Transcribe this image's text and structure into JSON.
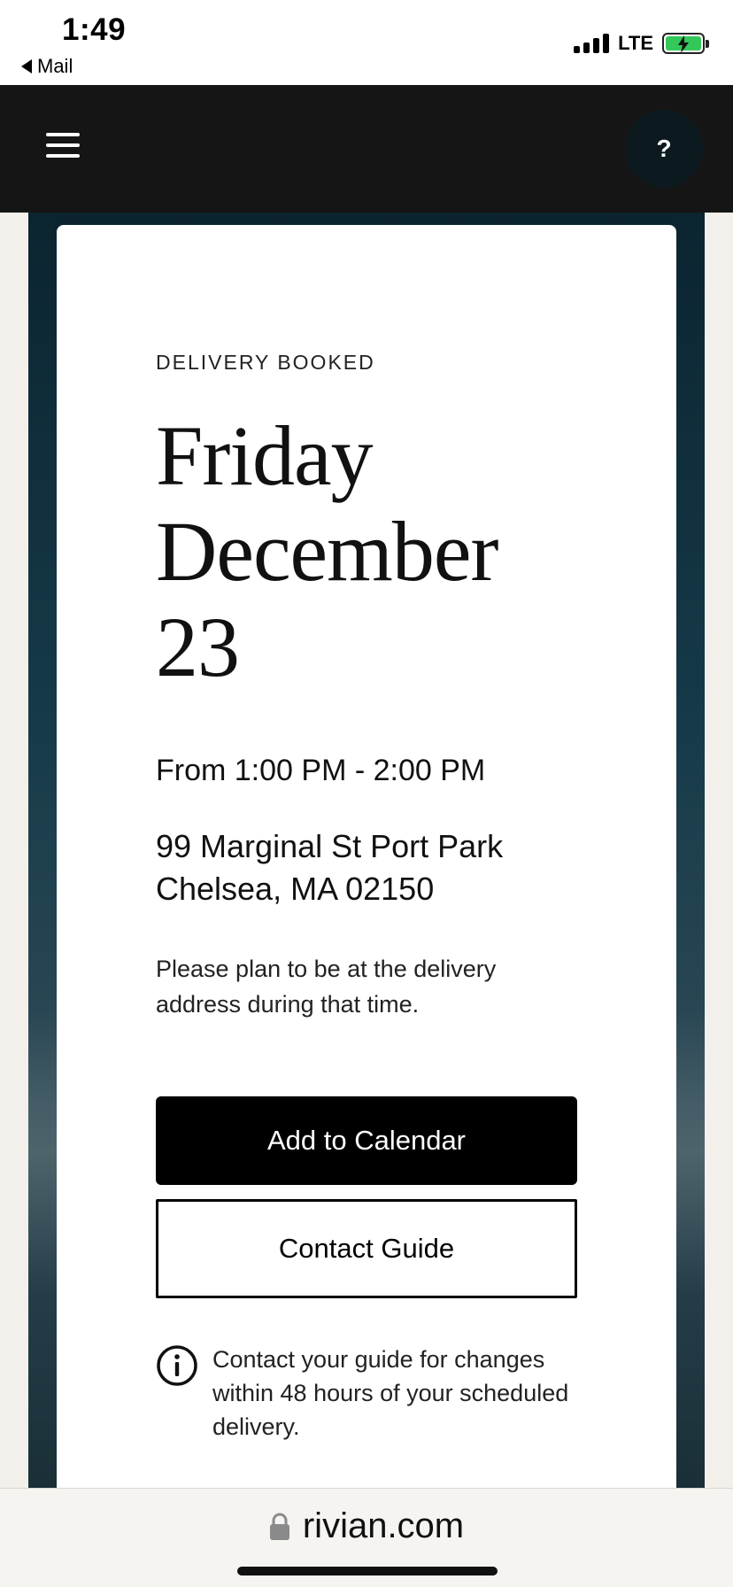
{
  "status_bar": {
    "time": "1:49",
    "back_app": "Mail",
    "network": "LTE",
    "battery_color": "#34c759"
  },
  "header": {
    "menu_icon": "hamburger-menu-icon",
    "help_label": "?"
  },
  "delivery": {
    "status_label": "DELIVERY BOOKED",
    "day": "Friday",
    "month": "December",
    "date": "23",
    "time_window": "From 1:00 PM - 2:00 PM",
    "address_line1": "99 Marginal St Port Park",
    "address_line2": "Chelsea, MA 02150",
    "note": "Please plan to be at the delivery address during that time.",
    "add_calendar_label": "Add to Calendar",
    "contact_guide_label": "Contact Guide",
    "info_icon": "info-circle-icon",
    "info_text": "Contact your guide for changes within 48 hours of your scheduled delivery."
  },
  "browser": {
    "lock_icon": "lock-icon",
    "url": "rivian.com"
  }
}
